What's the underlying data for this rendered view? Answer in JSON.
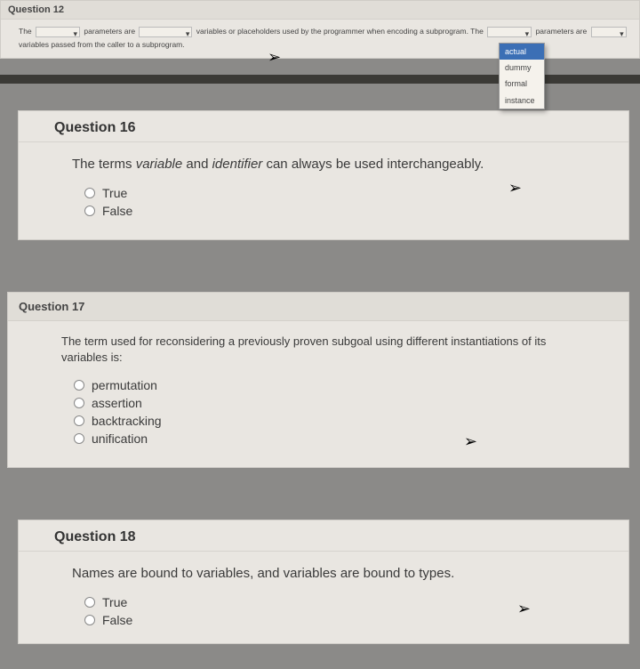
{
  "q12": {
    "header": "Question 12",
    "parts": {
      "t1": "The",
      "t2": "parameters are",
      "t3": "variables or placeholders used by the programmer when encoding a subprogram. The",
      "t4": "parameters are",
      "t5": "variables passed from the caller to a subprogram."
    },
    "dropdown": {
      "o1": "actual",
      "o2": "dummy",
      "o3": "formal",
      "o4": "instance"
    }
  },
  "q16": {
    "header": "Question 16",
    "text_pre": "The terms ",
    "italic1": "variable",
    "mid": " and ",
    "italic2": "identifier",
    "text_post": " can always be used interchangeably.",
    "opt_true": "True",
    "opt_false": "False"
  },
  "q17": {
    "header": "Question 17",
    "text": "The term used for reconsidering a previously proven subgoal using different instantiations of its variables is:",
    "opts": {
      "a": "permutation",
      "b": "assertion",
      "c": "backtracking",
      "d": "unification"
    }
  },
  "q18": {
    "header": "Question 18",
    "text": "Names are bound to variables, and variables are bound to types.",
    "opt_true": "True",
    "opt_false": "False"
  }
}
